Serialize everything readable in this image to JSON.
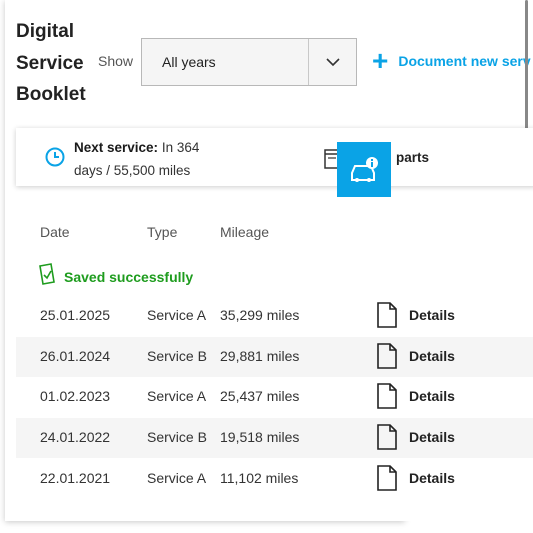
{
  "page": {
    "title": "Digital Service Booklet",
    "show_label": "Show",
    "filter_value": "All years",
    "document_new_label": "Document new serv"
  },
  "next_service": {
    "label": "Next service:",
    "text": "In 364 days / 55,500 miles"
  },
  "parts": {
    "label": "parts"
  },
  "table": {
    "headers": {
      "date": "Date",
      "type": "Type",
      "mileage": "Mileage"
    },
    "saved_message": "Saved successfully",
    "rows": [
      {
        "date": "25.01.2025",
        "type": "Service A",
        "mileage": "35,299 miles",
        "action": "Details"
      },
      {
        "date": "26.01.2024",
        "type": "Service B",
        "mileage": "29,881 miles",
        "action": "Details"
      },
      {
        "date": "01.02.2023",
        "type": "Service A",
        "mileage": "25,437 miles",
        "action": "Details"
      },
      {
        "date": "24.01.2022",
        "type": "Service B",
        "mileage": "19,518 miles",
        "action": "Details"
      },
      {
        "date": "22.01.2021",
        "type": "Service A",
        "mileage": "11,102 miles",
        "action": "Details"
      }
    ]
  },
  "colors": {
    "accent": "#0aa3e6",
    "success": "#1e9c1e",
    "row_shade": "#f5f5f5"
  },
  "icons": [
    "clock-icon",
    "chevron-down-icon",
    "plus-icon",
    "parts-icon",
    "car-info-icon",
    "saved-document-icon",
    "document-icon"
  ]
}
